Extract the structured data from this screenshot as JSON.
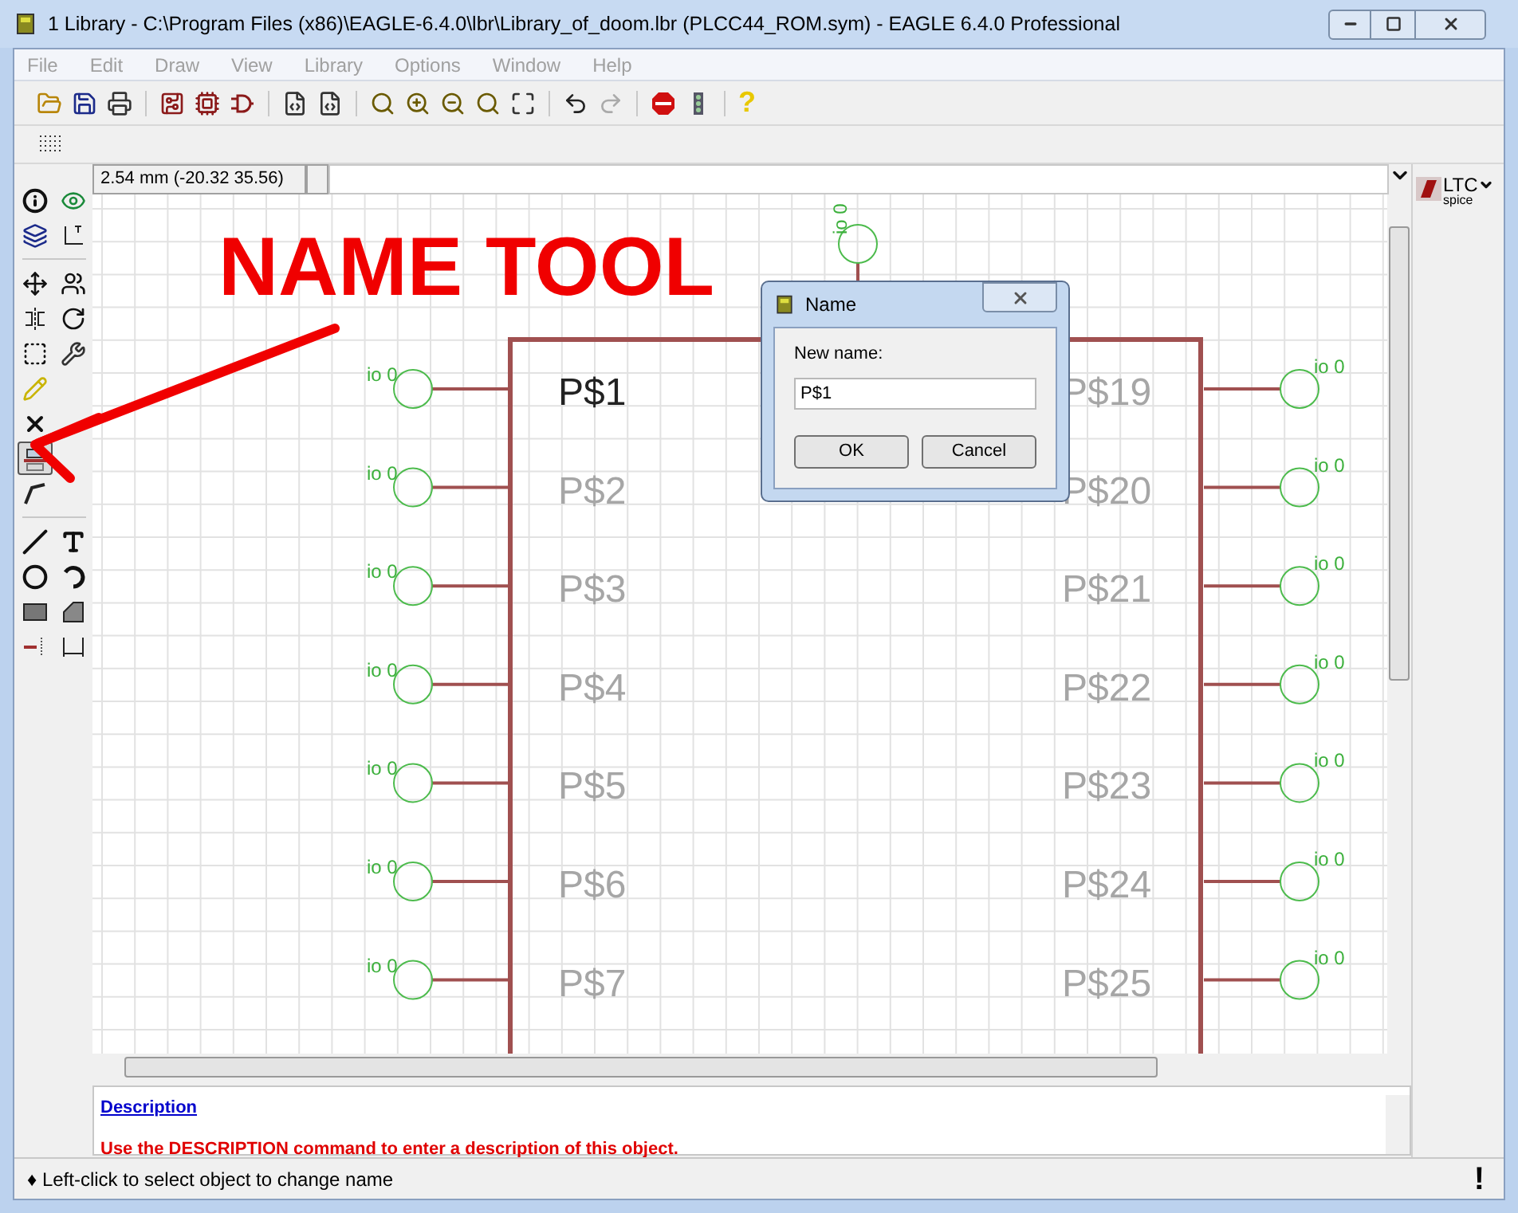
{
  "window": {
    "title": "1 Library - C:\\Program Files (x86)\\EAGLE-6.4.0\\lbr\\Library_of_doom.lbr (PLCC44_ROM.sym) - EAGLE 6.4.0 Professional"
  },
  "menu": [
    {
      "label": "File",
      "disabled": true
    },
    {
      "label": "Edit",
      "disabled": true
    },
    {
      "label": "Draw",
      "disabled": true
    },
    {
      "label": "View",
      "disabled": true
    },
    {
      "label": "Library",
      "disabled": true
    },
    {
      "label": "Options",
      "disabled": true
    },
    {
      "label": "Window",
      "disabled": true
    },
    {
      "label": "Help",
      "disabled": true
    }
  ],
  "help_button": "?",
  "toolbox": [
    {
      "selected": false
    },
    {
      "selected": false
    },
    {
      "selected": false
    },
    {
      "selected": false
    },
    {
      "selected": false
    },
    {
      "selected": false
    },
    {
      "selected": false
    },
    {
      "selected": false
    },
    {
      "selected": false
    },
    {
      "selected": false
    },
    {
      "selected": false
    },
    {
      "selected": false
    },
    {
      "selected": true
    },
    {
      "selected": false
    },
    {
      "selected": false
    },
    {
      "selected": false
    },
    {
      "selected": false
    },
    {
      "selected": false
    },
    {
      "selected": false
    },
    {
      "selected": false
    },
    {
      "selected": false
    },
    {
      "selected": false
    }
  ],
  "coordinates": "2.54 mm (-20.32 35.56)",
  "side_panel": {
    "logo_top": "LTC",
    "logo_bottom": "spice"
  },
  "symbol": {
    "top_pin": {
      "pad": "io 0"
    },
    "left_pins": [
      {
        "name": "P$1",
        "pad": "io 0",
        "highlighted": true
      },
      {
        "name": "P$2",
        "pad": "io 0",
        "highlighted": false
      },
      {
        "name": "P$3",
        "pad": "io 0",
        "highlighted": false
      },
      {
        "name": "P$4",
        "pad": "io 0",
        "highlighted": false
      },
      {
        "name": "P$5",
        "pad": "io 0",
        "highlighted": false
      },
      {
        "name": "P$6",
        "pad": "io 0",
        "highlighted": false
      },
      {
        "name": "P$7",
        "pad": "io 0",
        "highlighted": false
      }
    ],
    "right_pins": [
      {
        "name": "P$19",
        "pad": "io 0",
        "highlighted": false
      },
      {
        "name": "P$20",
        "pad": "io 0",
        "highlighted": false
      },
      {
        "name": "P$21",
        "pad": "io 0",
        "highlighted": false
      },
      {
        "name": "P$22",
        "pad": "io 0",
        "highlighted": false
      },
      {
        "name": "P$23",
        "pad": "io 0",
        "highlighted": false
      },
      {
        "name": "P$24",
        "pad": "io 0",
        "highlighted": false
      },
      {
        "name": "P$25",
        "pad": "io 0",
        "highlighted": false
      }
    ]
  },
  "dialog": {
    "title": "Name",
    "label": "New name:",
    "value": "P$1",
    "buttons": [
      "OK",
      "Cancel"
    ]
  },
  "description": {
    "heading": "Description",
    "text": "Use the DESCRIPTION command to enter a description of this object."
  },
  "status_bar": {
    "text": "♦ Left-click to select object to change name",
    "alert": "!"
  },
  "annotation": {
    "text": "NAME TOOL"
  }
}
